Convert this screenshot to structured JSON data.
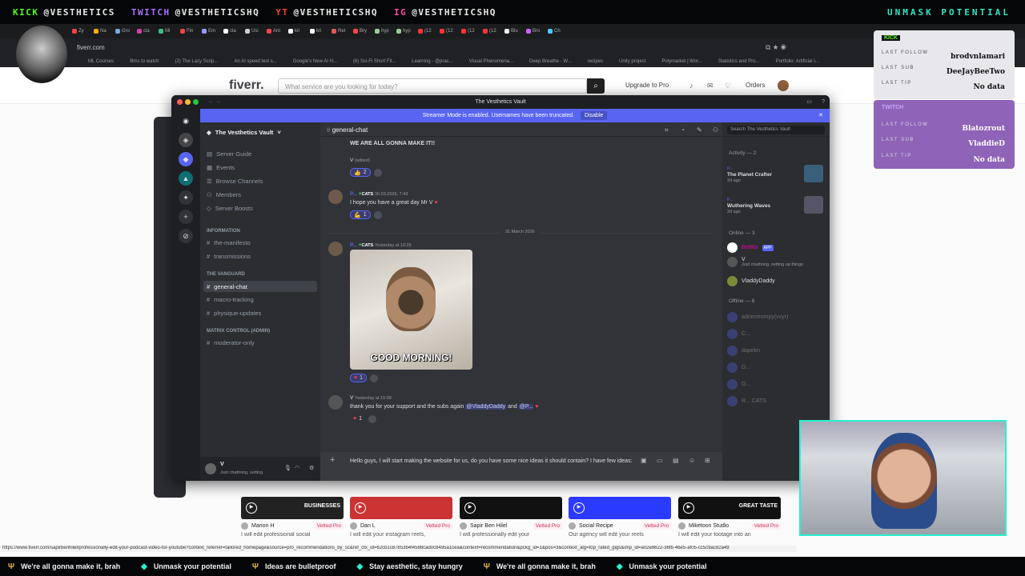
{
  "stream_top": {
    "socials": [
      {
        "platform": "KICK",
        "handle": "@VESTHETICS",
        "cls": "k"
      },
      {
        "platform": "TWITCH",
        "handle": "@VESTHETICSHQ",
        "cls": "t"
      },
      {
        "platform": "YT",
        "handle": "@VESTHETICSHQ",
        "cls": "y"
      },
      {
        "platform": "IG",
        "handle": "@VESTHETICSHQ",
        "cls": "i"
      }
    ],
    "slogan": "UNMASK POTENTIAL"
  },
  "browser": {
    "tab_labels": [
      "Zy",
      "Na",
      "Gro",
      "cla",
      "Mi",
      "Fin",
      "Em",
      "cla",
      "Usi",
      "Ant",
      "kri",
      "kri",
      "Ret",
      "Bry",
      "hyp",
      "hyp",
      "(12",
      "(12",
      "(12",
      "(12",
      "Blu",
      "Bro",
      "Ch"
    ],
    "url": "fiverr.com",
    "bookmarks": [
      "ML Courses",
      "films to watch",
      "(2) The Lazy Scrip...",
      "An AI speed test s...",
      "Google's New AI H...",
      "(6) Sci-Fi Short Fil...",
      "Learning - @prac...",
      "Visual Phenomena...",
      "Deep Breathe - W...",
      "recipes",
      "Unity project",
      "Polymarket | Wor...",
      "Statistics and Pro...",
      "Portfolio: Artificial I..."
    ]
  },
  "fiverr": {
    "logo": "fiverr.",
    "search_placeholder": "What service are you looking for today?",
    "upgrade": "Upgrade to Pro",
    "orders": "Orders",
    "gigs": [
      {
        "seller": "Marion H",
        "badge": "Vetted Pro",
        "desc": "I will edit professional social",
        "thumb_text": "BUSINESSES"
      },
      {
        "seller": "Dan L",
        "badge": "Vetted Pro",
        "desc": "I will edit your instagram reels,",
        "thumb_text": ""
      },
      {
        "seller": "Sapir Ben Hilel",
        "badge": "Vetted Pro",
        "desc": "I will professionally edit your",
        "thumb_text": ""
      },
      {
        "seller": "Social Recipe",
        "badge": "Vetted Pro",
        "desc": "Our agency will edit your reels",
        "thumb_text": ""
      },
      {
        "seller": "Miketoon Studio",
        "badge": "Vetted Pro",
        "desc": "I will edit your footage into an",
        "thumb_text": "GREAT TASTE"
      }
    ],
    "status_url": "https://www.fiverr.com/sapirbenhilel/professionally-edit-your-podcast-video-for-youtube?context_referrer=tailored_homepage&source=pro_recommendations_by_sc&ref_ctx_id=62cb1c87853b4f4588cad0c8495a1cea&context=recommendation&pckg_id=1&pos=3&context_alg=top_rated_gigs&imp_id=a02e8622-36fb-46e5-af05-cc5c9ac82a49"
  },
  "discord": {
    "window_title": "The Vesthetics Vault",
    "banner_text": "Streamer Mode is enabled. Usernames have been truncated.",
    "banner_button": "Disable",
    "server_name": "The Vesthetics Vault",
    "top_links": [
      "Server Guide",
      "Events",
      "Browse Channels",
      "Members",
      "Server Boosts"
    ],
    "categories": [
      {
        "name": "INFORMATION",
        "channels": [
          "the-manifesto",
          "transmissions"
        ]
      },
      {
        "name": "THE VANGUARD",
        "channels": [
          "general-chat",
          "macro-tracking",
          "physique-updates"
        ]
      },
      {
        "name": "MATRIX CONTROL (ADMIN)",
        "channels": [
          "moderator-only"
        ]
      }
    ],
    "current_channel": "general-chat",
    "search_placeholder": "Search The Vesthetics Vault",
    "user": {
      "name": "V",
      "status": "Just chattning, setting"
    },
    "messages": {
      "m0_text": "WE ARE ALL GONNA MAKE IT!!",
      "m0_author": "V",
      "m0_edited": "(edited)",
      "m0_react": "2",
      "m1_author": "P...",
      "m1_tag": "CATS",
      "m1_time": "30.03.2026, 7:43",
      "m1_text": "I hope you have a great day Mr V",
      "m1_react": "1",
      "date_divider": "31 March 2026",
      "m2_author": "P...",
      "m2_tag": "CATS",
      "m2_time": "Yesterday at 10:26",
      "m2_image_caption": "GOOD MORNING!",
      "m2_react": "1",
      "m3_author": "V",
      "m3_time": "Yesterday at 15:09",
      "m3_text": "thank you for your support and the subs again",
      "m3_mention1": "@VladdyDaddy",
      "m3_and": "and",
      "m3_mention2": "@P...",
      "m3_react": "1"
    },
    "composer_text": "Hello guys, I will start making the website for us, do you have some nice ideas it should contain? I have few ideas:",
    "members": {
      "activity_header": "Activity — 2",
      "activities": [
        {
          "user": "P...",
          "title": "The Planet Crafter",
          "time": "2d ago"
        },
        {
          "user": "P...",
          "title": "Wuthering Waves",
          "time": "2d ago"
        }
      ],
      "online_header": "Online — 3",
      "online": [
        {
          "name": "BotRix",
          "badge": "APP",
          "status": ""
        },
        {
          "name": "V",
          "badge": "",
          "status": "Just chattning, setting up things"
        },
        {
          "name": "VladdyDaddy",
          "badge": "",
          "status": ""
        }
      ],
      "offline_header": "Offline — 6",
      "offline": [
        "adrientrompy(vvyr)",
        "C...",
        "dapekn",
        "D...",
        "D...",
        "R...  CATS"
      ]
    }
  },
  "panels": {
    "kick": {
      "title": "KICK",
      "last_follow": "brodvnlamari",
      "last_sub": "DeeJayBeeTwo",
      "last_tip": "No data"
    },
    "twitch": {
      "title": "TWITCH",
      "last_follow": "Blatozrout",
      "last_sub": "VladdieD",
      "last_tip": "No data"
    },
    "labels": {
      "follow": "LAST FOLLOW",
      "sub": "LAST SUB",
      "tip": "LAST TIP"
    }
  },
  "ticker": [
    "We're all gonna make it, brah",
    "Unmask your potential",
    "Ideas are bulletproof",
    "Stay aesthetic, stay hungry",
    "We're all gonna make it, brah",
    "Unmask your potential"
  ],
  "colors": {
    "discord_blurple": "#5865f2",
    "kick_green": "#53fc18",
    "twitch_purple": "#a970ff",
    "accent_teal": "#29f0cf"
  }
}
